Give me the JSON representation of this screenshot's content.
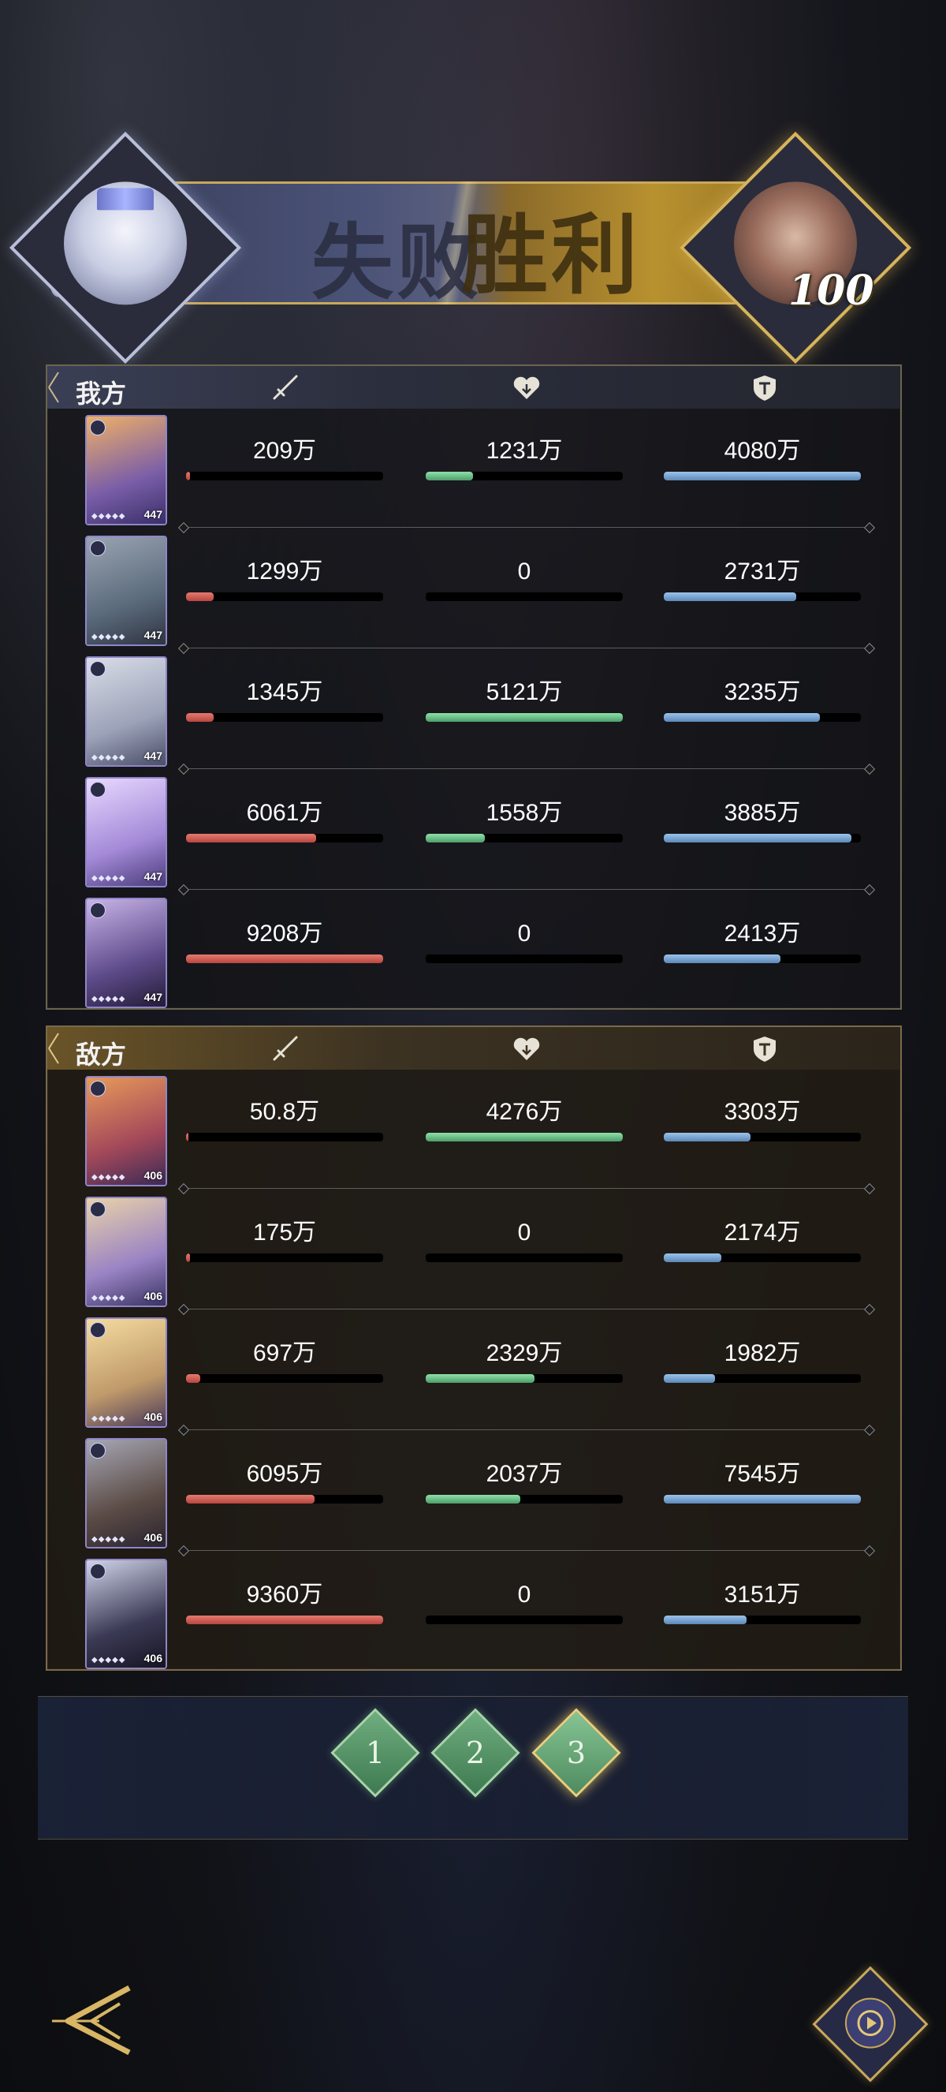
{
  "header": {
    "lose_label": "失败",
    "win_label": "胜利",
    "enemy_level": "100"
  },
  "colors": {
    "attack": "#c9524a",
    "heal": "#67b882",
    "defense": "#76a2d0",
    "gold": "#c9a85a"
  },
  "my_side": {
    "title": "我方",
    "rows": [
      {
        "atk": "209万",
        "atk_pct": 2,
        "heal": "1231万",
        "heal_pct": 24,
        "def": "4080万",
        "def_pct": 100,
        "lv": "447"
      },
      {
        "atk": "1299万",
        "atk_pct": 14,
        "heal": "0",
        "heal_pct": 0,
        "def": "2731万",
        "def_pct": 67,
        "lv": "447"
      },
      {
        "atk": "1345万",
        "atk_pct": 14,
        "heal": "5121万",
        "heal_pct": 100,
        "def": "3235万",
        "def_pct": 79,
        "lv": "447"
      },
      {
        "atk": "6061万",
        "atk_pct": 66,
        "heal": "1558万",
        "heal_pct": 30,
        "def": "3885万",
        "def_pct": 95,
        "lv": "447"
      },
      {
        "atk": "9208万",
        "atk_pct": 100,
        "heal": "0",
        "heal_pct": 0,
        "def": "2413万",
        "def_pct": 59,
        "lv": "447"
      }
    ]
  },
  "enemy_side": {
    "title": "敌方",
    "rows": [
      {
        "atk": "50.8万",
        "atk_pct": 1,
        "heal": "4276万",
        "heal_pct": 100,
        "def": "3303万",
        "def_pct": 44,
        "lv": "406"
      },
      {
        "atk": "175万",
        "atk_pct": 2,
        "heal": "0",
        "heal_pct": 0,
        "def": "2174万",
        "def_pct": 29,
        "lv": "406"
      },
      {
        "atk": "697万",
        "atk_pct": 7,
        "heal": "2329万",
        "heal_pct": 55,
        "def": "1982万",
        "def_pct": 26,
        "lv": "406"
      },
      {
        "atk": "6095万",
        "atk_pct": 65,
        "heal": "2037万",
        "heal_pct": 48,
        "def": "7545万",
        "def_pct": 100,
        "lv": "406"
      },
      {
        "atk": "9360万",
        "atk_pct": 100,
        "heal": "0",
        "heal_pct": 0,
        "def": "3151万",
        "def_pct": 42,
        "lv": "406"
      }
    ]
  },
  "rounds": {
    "items": [
      "1",
      "2",
      "3"
    ],
    "active_index": 2
  },
  "icons": {
    "attack": "sword-icon",
    "heal": "heart-icon",
    "defense": "shield-icon",
    "back": "back-arrow-icon",
    "replay": "replay-icon"
  }
}
